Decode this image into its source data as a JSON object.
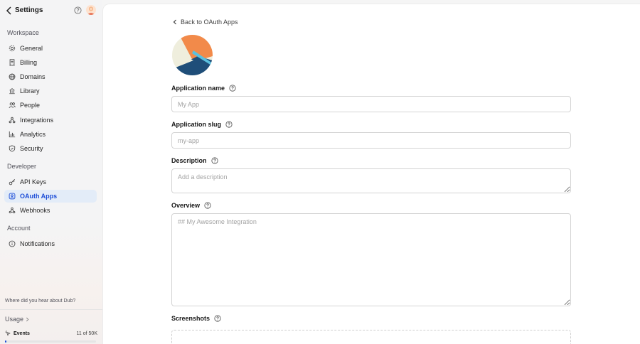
{
  "sidebar": {
    "title": "Settings",
    "sections": {
      "workspace": {
        "label": "Workspace",
        "items": [
          {
            "label": "General",
            "icon": "gear-icon"
          },
          {
            "label": "Billing",
            "icon": "receipt-icon"
          },
          {
            "label": "Domains",
            "icon": "globe-icon"
          },
          {
            "label": "Library",
            "icon": "library-icon"
          },
          {
            "label": "People",
            "icon": "users-icon"
          },
          {
            "label": "Integrations",
            "icon": "integrations-icon"
          },
          {
            "label": "Analytics",
            "icon": "chart-icon"
          },
          {
            "label": "Security",
            "icon": "shield-icon"
          }
        ]
      },
      "developer": {
        "label": "Developer",
        "items": [
          {
            "label": "API Keys",
            "icon": "key-icon"
          },
          {
            "label": "OAuth Apps",
            "icon": "oauth-icon",
            "active": true
          },
          {
            "label": "Webhooks",
            "icon": "webhook-icon"
          }
        ]
      },
      "account": {
        "label": "Account",
        "items": [
          {
            "label": "Notifications",
            "icon": "info-circle-icon"
          }
        ]
      }
    },
    "survey_prompt": "Where did you hear about Dub?",
    "usage": {
      "label": "Usage",
      "events_label": "Events",
      "events_count": "11 of 50K",
      "progress": 0.0002
    }
  },
  "main": {
    "back_link": "Back to OAuth Apps",
    "fields": {
      "name": {
        "label": "Application name",
        "placeholder": "My App"
      },
      "slug": {
        "label": "Application slug",
        "placeholder": "my-app"
      },
      "description": {
        "label": "Description",
        "placeholder": "Add a description"
      },
      "overview": {
        "label": "Overview",
        "placeholder": "## My Awesome Integration"
      },
      "screenshots": {
        "label": "Screenshots"
      }
    }
  },
  "colors": {
    "accent": "#1d4ed8",
    "active_bg": "#e3ecf8",
    "logo_orange": "#f28a4a",
    "logo_navy": "#1f4e79",
    "logo_cream": "#efeedd",
    "logo_cyan": "#5bc0de"
  }
}
